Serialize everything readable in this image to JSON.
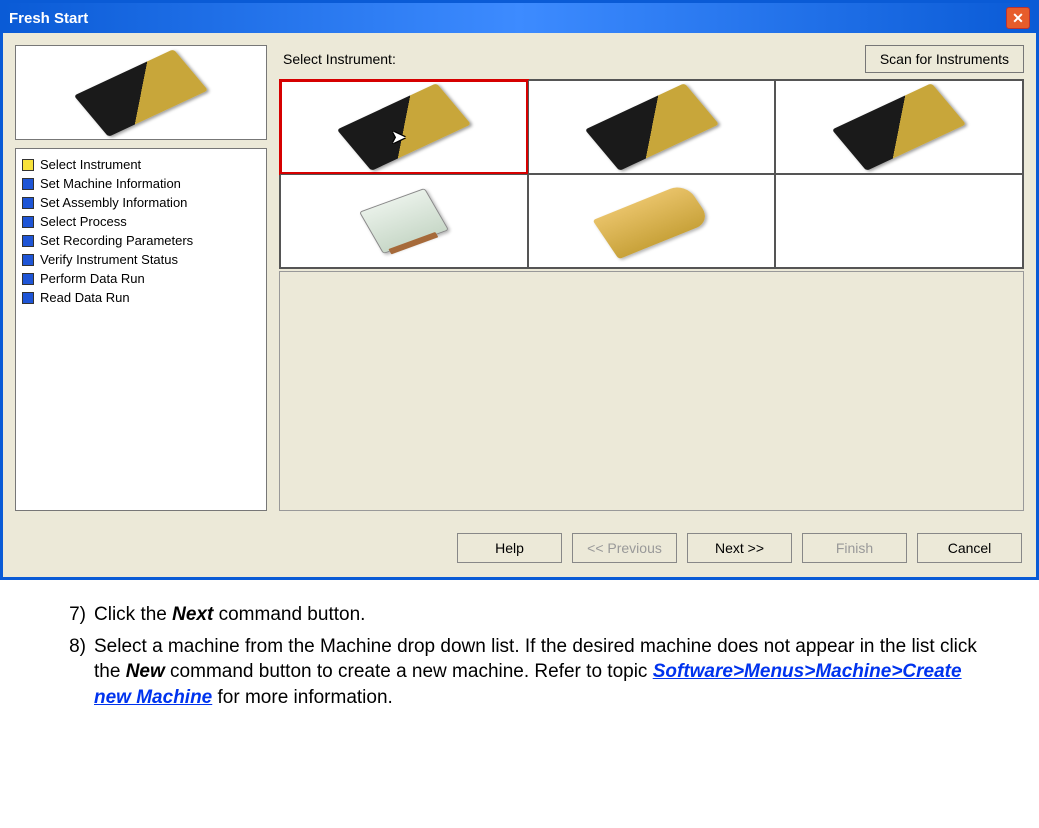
{
  "dialog": {
    "title": "Fresh Start",
    "close_glyph": "✕"
  },
  "steps": [
    {
      "state": "yellow",
      "label": "Select Instrument"
    },
    {
      "state": "blue",
      "label": "Set Machine Information"
    },
    {
      "state": "blue",
      "label": "Set Assembly Information"
    },
    {
      "state": "blue",
      "label": "Select Process"
    },
    {
      "state": "blue",
      "label": "Set Recording Parameters"
    },
    {
      "state": "blue",
      "label": "Verify Instrument Status"
    },
    {
      "state": "blue",
      "label": "Perform Data Run"
    },
    {
      "state": "blue",
      "label": "Read Data Run"
    }
  ],
  "right": {
    "select_label": "Select Instrument:",
    "scan_label": "Scan for Instruments"
  },
  "buttons": {
    "help": "Help",
    "prev": "<< Previous",
    "next": "Next >>",
    "finish": "Finish",
    "cancel": "Cancel"
  },
  "doc": {
    "item7_num": "7)",
    "item7_pre": "Click the ",
    "item7_bold": "Next",
    "item7_post": " command button.",
    "item8_num": "8)",
    "item8_pre": "Select a machine from the Machine drop down list. If the desired machine does not appear in the list click the ",
    "item8_bold": "New",
    "item8_mid": " command button to create a new machine. Refer to topic ",
    "item8_link": "Software>Menus>Machine>Create new Machine",
    "item8_post": " for more information."
  }
}
